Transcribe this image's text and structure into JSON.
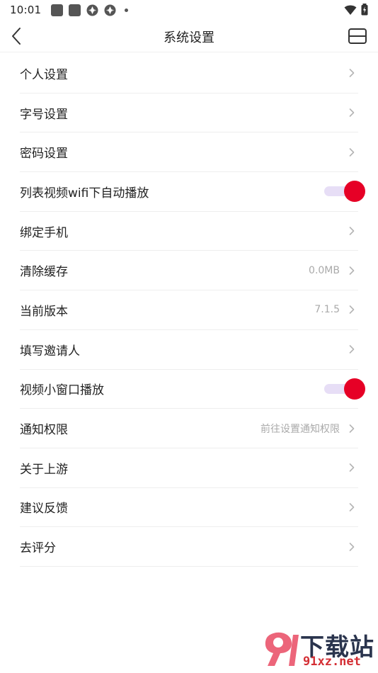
{
  "status_bar": {
    "time": "10:01"
  },
  "nav": {
    "title": "系统设置"
  },
  "settings": [
    {
      "label": "个人设置",
      "type": "link"
    },
    {
      "label": "字号设置",
      "type": "link"
    },
    {
      "label": "密码设置",
      "type": "link"
    },
    {
      "label": "列表视频wifi下自动播放",
      "type": "toggle",
      "on": true
    },
    {
      "label": "绑定手机",
      "type": "link"
    },
    {
      "label": "清除缓存",
      "type": "link",
      "value": "0.0MB"
    },
    {
      "label": "当前版本",
      "type": "link",
      "value": "7.1.5"
    },
    {
      "label": "填写邀请人",
      "type": "link"
    },
    {
      "label": "视频小窗口播放",
      "type": "toggle",
      "on": true
    },
    {
      "label": "通知权限",
      "type": "link",
      "value": "前往设置通知权限"
    },
    {
      "label": "关于上游",
      "type": "link"
    },
    {
      "label": "建议反馈",
      "type": "link"
    },
    {
      "label": "去评分",
      "type": "link"
    }
  ],
  "watermark": {
    "text": "下载站",
    "url": "91xz.net"
  },
  "colors": {
    "accent": "#e60026",
    "toggle_track": "#e7def6",
    "secondary_text": "#aaaaaa",
    "divider": "#eeeeee"
  }
}
